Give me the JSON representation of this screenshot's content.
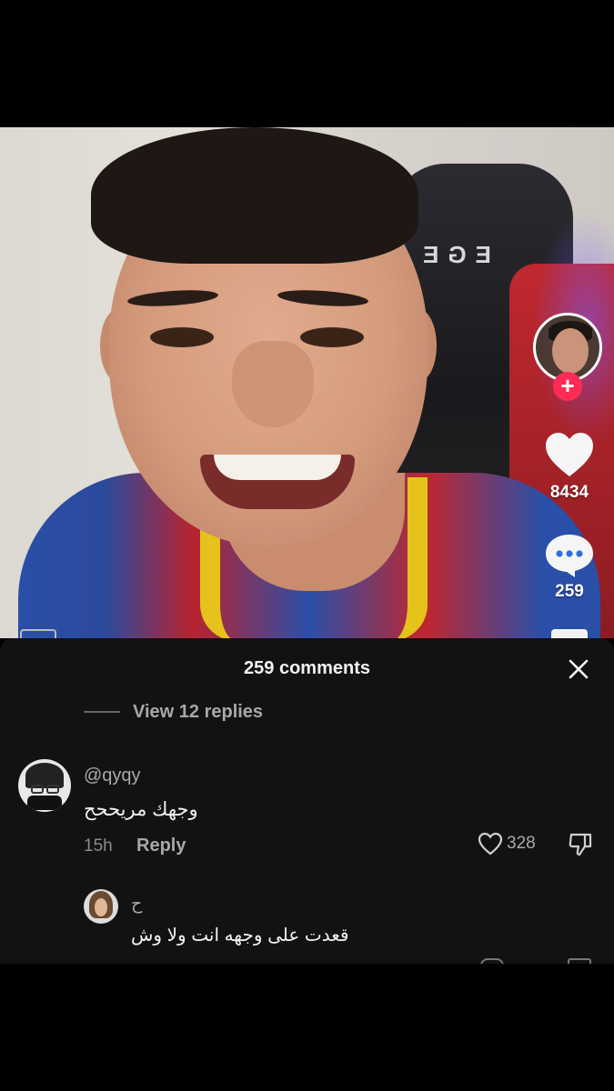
{
  "video": {
    "chair_brand_text": "EGE",
    "creator_avatar": "creator-avatar",
    "follow_symbol": "+",
    "like_count": "8434",
    "comment_count": "259"
  },
  "comments_sheet": {
    "title": "259 comments",
    "close_symbol": "×",
    "view_replies": "View 12 replies",
    "comment": {
      "username": "@qyqy",
      "text": "وجهك مريححح",
      "time": "15h",
      "reply_label": "Reply",
      "likes": "328"
    },
    "reply": {
      "username": "ح",
      "text": "قعدت على وجهه انت ولا وش"
    }
  },
  "colors": {
    "accent": "#fe2c55",
    "sheet_bg": "#121212",
    "muted_text": "#a8a8a8"
  },
  "icons": [
    "heart-icon",
    "comment-bubble-icon",
    "close-icon",
    "dislike-icon",
    "plus-icon"
  ]
}
